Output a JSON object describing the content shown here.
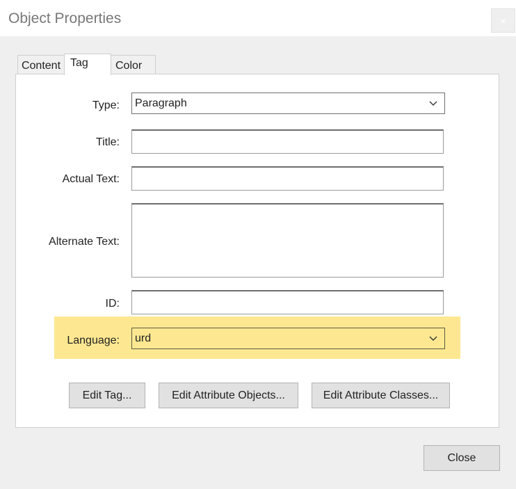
{
  "window": {
    "title": "Object Properties",
    "close_glyph": "×"
  },
  "tabs": [
    {
      "label": "Content",
      "active": false
    },
    {
      "label": "Tag",
      "active": true
    },
    {
      "label": "Color",
      "active": false
    }
  ],
  "form": {
    "type_label": "Type:",
    "type_value": "Paragraph",
    "title_label": "Title:",
    "title_value": "",
    "actual_text_label": "Actual Text:",
    "actual_text_value": "",
    "alternate_text_label": "Alternate Text:",
    "alternate_text_value": "",
    "id_label": "ID:",
    "id_value": "",
    "language_label": "Language:",
    "language_value": "urd"
  },
  "buttons": {
    "edit_tag": "Edit Tag...",
    "edit_attribute_objects": "Edit Attribute Objects...",
    "edit_attribute_classes": "Edit Attribute Classes...",
    "close": "Close"
  },
  "colors": {
    "highlight": "#fde891",
    "dialog_background": "#efefef"
  },
  "icons": {
    "dropdown": "chevron-down-icon",
    "window_close": "close-icon"
  }
}
